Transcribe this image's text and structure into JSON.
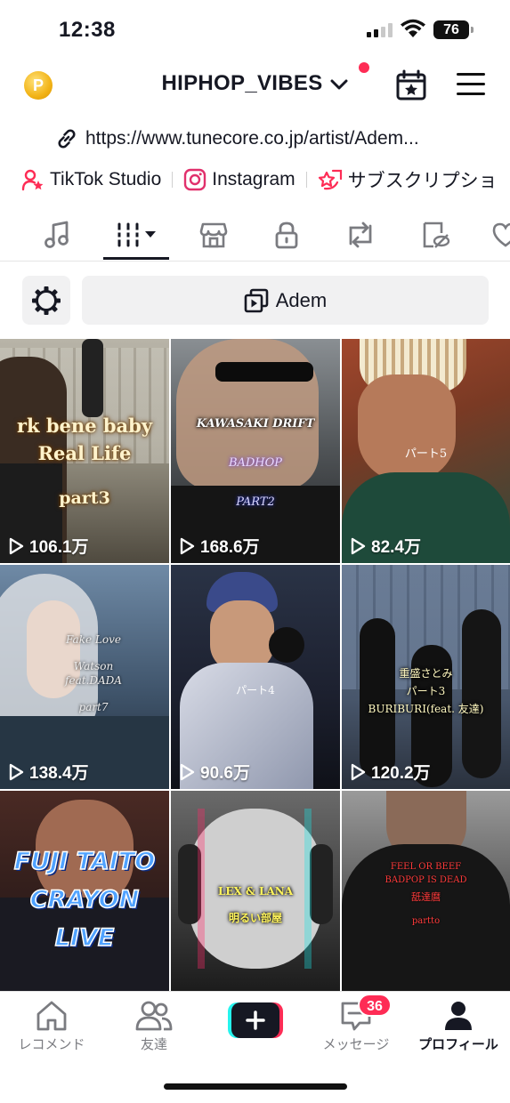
{
  "status_bar": {
    "time": "12:38",
    "battery": "76"
  },
  "header": {
    "username": "HIPHOP_VIBES",
    "coin_symbol": "P"
  },
  "profile_link": {
    "url": "https://www.tunecore.co.jp/artist/Adem..."
  },
  "socials": [
    {
      "label": "TikTok Studio",
      "icon": "tiktok-studio-icon"
    },
    {
      "label": "Instagram",
      "icon": "instagram-icon"
    },
    {
      "label": "サブスクリプショ",
      "icon": "subscription-icon"
    }
  ],
  "tabs": [
    "music-note-icon",
    "playlist-grid-icon",
    "shop-icon",
    "lock-icon",
    "repost-icon",
    "hidden-icon",
    "liked-icon"
  ],
  "playlist_filter": {
    "label": "Adem"
  },
  "videos": [
    {
      "views": "106.1万",
      "caption": [
        "rk bene baby",
        "Real Life",
        "part3"
      ]
    },
    {
      "views": "168.6万",
      "caption": [
        "KAWASAKI DRIFT",
        "BADHOP",
        "PART2"
      ]
    },
    {
      "views": "82.4万",
      "caption": [
        "パート5"
      ]
    },
    {
      "views": "138.4万",
      "caption": [
        "Fake Love",
        "Watson",
        "feat.DADA",
        "part7"
      ]
    },
    {
      "views": "90.6万",
      "caption": [
        "パート4"
      ]
    },
    {
      "views": "120.2万",
      "caption": [
        "重盛さとみ",
        "パート3",
        "BURIBURI(feat. 友達)"
      ]
    },
    {
      "views": "",
      "caption": [
        "FUJI TAITO",
        "CRAYON",
        "LIVE"
      ]
    },
    {
      "views": "",
      "caption": [
        "LEX & LANA",
        "明るい部屋"
      ]
    },
    {
      "views": "",
      "caption": [
        "FEEL OR BEEF",
        "BADPOP IS DEAD",
        "舐達麿",
        "partto"
      ]
    }
  ],
  "bottom_nav": {
    "home": "レコメンド",
    "friends": "友達",
    "messages": "メッセージ",
    "messages_badge": "36",
    "profile": "プロフィール"
  },
  "colors": {
    "accent": "#fe2c55",
    "text": "#161823",
    "muted": "#7a7b80"
  }
}
